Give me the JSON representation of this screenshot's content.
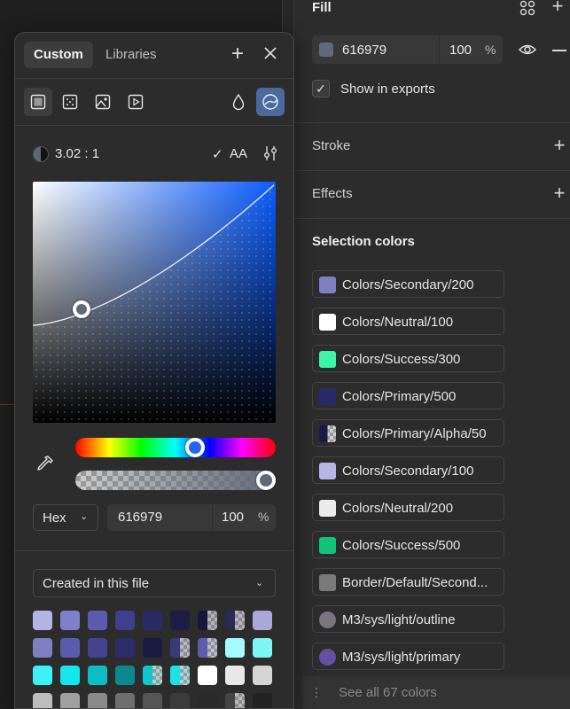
{
  "right_panel": {
    "fill": {
      "title": "Fill",
      "hex": "616979",
      "opacity": "100",
      "percent": "%",
      "swatch_color": "#616979"
    },
    "show_in_exports": "Show in exports",
    "stroke": "Stroke",
    "effects": "Effects",
    "selection_colors_title": "Selection colors",
    "selection_colors": [
      {
        "label": "Colors/Secondary/200",
        "color": "#7e7fc0",
        "shape": "square"
      },
      {
        "label": "Colors/Neutral/100",
        "color": "#ffffff",
        "shape": "square"
      },
      {
        "label": "Colors/Success/300",
        "color": "#3ef4a8",
        "shape": "square"
      },
      {
        "label": "Colors/Primary/500",
        "color": "#2a2a6a",
        "shape": "square"
      },
      {
        "label": "Colors/Primary/Alpha/50",
        "color": "#1a1a44",
        "shape": "half-transparent"
      },
      {
        "label": "Colors/Secondary/100",
        "color": "#b6b6e4",
        "shape": "square"
      },
      {
        "label": "Colors/Neutral/200",
        "color": "#ececec",
        "shape": "square"
      },
      {
        "label": "Colors/Success/500",
        "color": "#10c27a",
        "shape": "square"
      },
      {
        "label": "Border/Default/Second...",
        "color": "#7a7a7a",
        "shape": "square"
      },
      {
        "label": "M3/sys/light/outline",
        "color": "#79767f",
        "shape": "round"
      },
      {
        "label": "M3/sys/light/primary",
        "color": "#6750a4",
        "shape": "round"
      }
    ],
    "see_all": "See all 67 colors"
  },
  "picker": {
    "tabs": [
      "Custom",
      "Libraries"
    ],
    "contrast": "3.02 : 1",
    "aa": "AA",
    "current_color": "#616979",
    "format": "Hex",
    "hex": "616979",
    "opacity": "100",
    "percent": "%",
    "library_source": "Created in this file",
    "swatch_rows": [
      [
        "#b4b4e4",
        "#8080c8",
        "#5b5bb0",
        "#403f8d",
        "#2a2a66",
        "#1c1c44",
        "#16163a|half",
        "#2a2a55|half",
        "#aaa8d8"
      ],
      [
        "#7e7fc0",
        "#5c5cae",
        "#45428f",
        "#2c2c6a",
        "#1a1a40",
        "#3a3a7a|half",
        "#5c5cae|half",
        "#a6fbff",
        "#7ff6f6"
      ],
      [
        "#3df2f6",
        "#14e6ea",
        "#0cbdc4",
        "#0a8a90",
        "#0ec8cc|half",
        "#1ae4e8|half",
        "#ffffff",
        "#e8e8e8",
        "#d4d4d4"
      ],
      [
        "#bdbdbd",
        "#a0a0a0",
        "#8a8a8a",
        "#6e6e6e",
        "#555555",
        "#3b3b3b",
        "#2a2a2a",
        "#444444|half",
        "#222222"
      ]
    ]
  }
}
